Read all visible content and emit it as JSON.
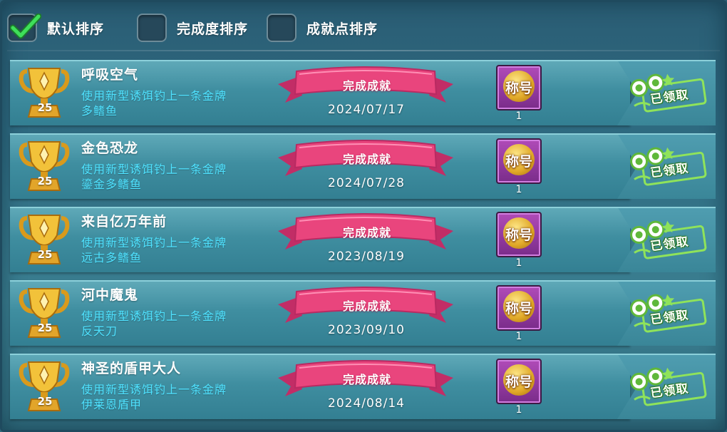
{
  "sort_options": [
    {
      "label": "默认排序",
      "checked": true
    },
    {
      "label": "完成度排序",
      "checked": false
    },
    {
      "label": "成就点排序",
      "checked": false
    }
  ],
  "achievements": [
    {
      "points": "25",
      "title": "呼吸空气",
      "desc_line1": "使用新型诱饵钓上一条金牌",
      "desc_line2": "多鳍鱼",
      "status": "完成成就",
      "date": "2024/07/17",
      "reward_label": "称号",
      "reward_count": "1",
      "claim_label": "已领取"
    },
    {
      "points": "25",
      "title": "金色恐龙",
      "desc_line1": "使用新型诱饵钓上一条金牌",
      "desc_line2": "鎏金多鳍鱼",
      "status": "完成成就",
      "date": "2024/07/28",
      "reward_label": "称号",
      "reward_count": "1",
      "claim_label": "已领取"
    },
    {
      "points": "25",
      "title": "来自亿万年前",
      "desc_line1": "使用新型诱饵钓上一条金牌",
      "desc_line2": "远古多鳍鱼",
      "status": "完成成就",
      "date": "2023/08/19",
      "reward_label": "称号",
      "reward_count": "1",
      "claim_label": "已领取"
    },
    {
      "points": "25",
      "title": "河中魔鬼",
      "desc_line1": "使用新型诱饵钓上一条金牌",
      "desc_line2": "反天刀",
      "status": "完成成就",
      "date": "2023/09/10",
      "reward_label": "称号",
      "reward_count": "1",
      "claim_label": "已领取"
    },
    {
      "points": "25",
      "title": "神圣的盾甲大人",
      "desc_line1": "使用新型诱饵钓上一条金牌",
      "desc_line2": "伊莱恩盾甲",
      "status": "完成成就",
      "date": "2024/08/14",
      "reward_label": "称号",
      "reward_count": "1",
      "claim_label": "已领取"
    }
  ],
  "colors": {
    "check": "#3ee05a",
    "description": "#4fe2ff",
    "ribbon": "#e9457d",
    "stamp": "#8fe35a"
  },
  "icons": [
    "check-icon",
    "trophy-icon",
    "ribbon-banner",
    "title-badge-icon",
    "claimed-stamp-icon"
  ]
}
